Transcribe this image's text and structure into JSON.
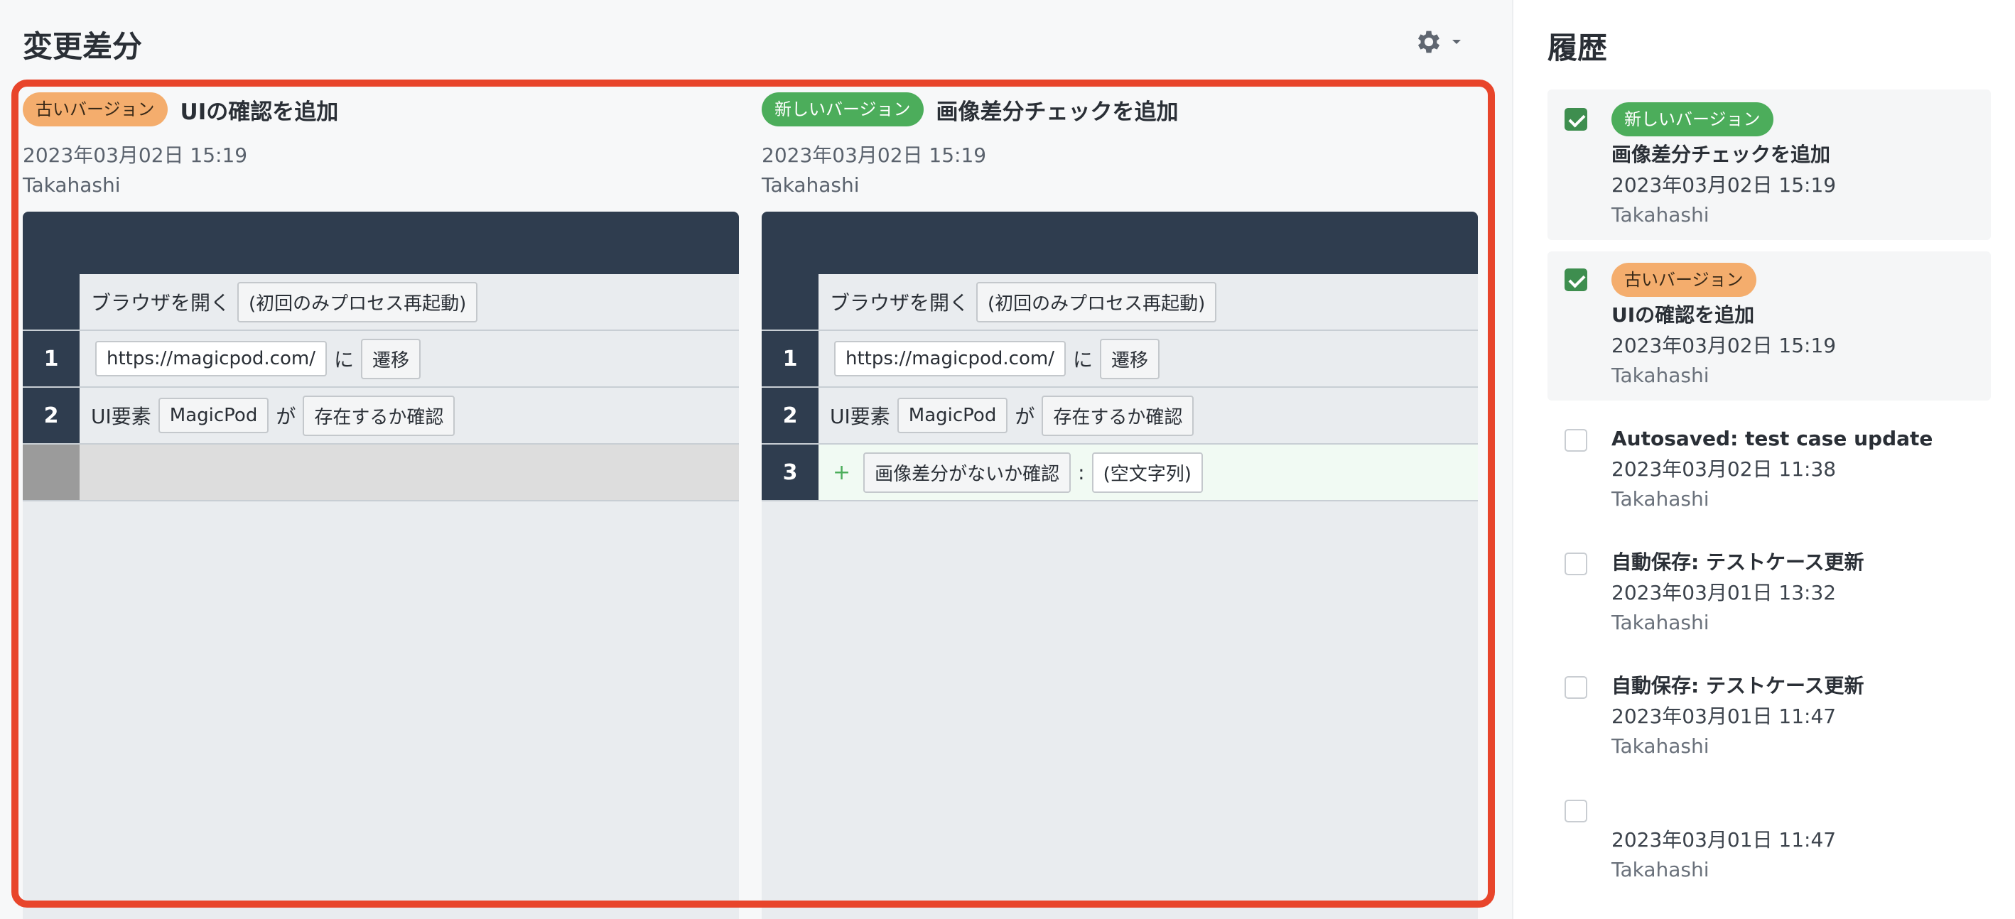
{
  "main": {
    "title": "変更差分",
    "settings_icon": "gear-icon"
  },
  "old_panel": {
    "badge": "古いバージョン",
    "title": "UIの確認を追加",
    "date": "2023年03月02日 15:19",
    "author": "Takahashi",
    "steps": [
      {
        "num": "",
        "parts": [
          "ブラウザを開く",
          "(初回のみプロセス再起動)"
        ]
      },
      {
        "num": "1",
        "parts": [
          "https://magicpod.com/",
          "に",
          "遷移"
        ]
      },
      {
        "num": "2",
        "parts": [
          "UI要素",
          "MagicPod",
          "が",
          "存在するか確認"
        ]
      }
    ]
  },
  "new_panel": {
    "badge": "新しいバージョン",
    "title": "画像差分チェックを追加",
    "date": "2023年03月02日 15:19",
    "author": "Takahashi",
    "steps": [
      {
        "num": "",
        "parts": [
          "ブラウザを開く",
          "(初回のみプロセス再起動)"
        ]
      },
      {
        "num": "1",
        "parts": [
          "https://magicpod.com/",
          "に",
          "遷移"
        ]
      },
      {
        "num": "2",
        "parts": [
          "UI要素",
          "MagicPod",
          "が",
          "存在するか確認"
        ]
      },
      {
        "num": "3",
        "plus": "+",
        "parts": [
          "画像差分がないか確認",
          ":",
          "(空文字列)"
        ]
      }
    ]
  },
  "history": {
    "title": "履歴",
    "items": [
      {
        "checked": true,
        "badge": "新しいバージョン",
        "badge_color": "#4cad5b",
        "title": "画像差分チェックを追加",
        "date": "2023年03月02日 15:19",
        "author": "Takahashi"
      },
      {
        "checked": true,
        "badge": "古いバージョン",
        "badge_color": "#f4ad6d",
        "title": "UIの確認を追加",
        "date": "2023年03月02日 15:19",
        "author": "Takahashi"
      },
      {
        "checked": false,
        "title": "Autosaved: test case update",
        "date": "2023年03月02日 11:38",
        "author": "Takahashi"
      },
      {
        "checked": false,
        "title": "自動保存: テストケース更新",
        "date": "2023年03月01日 13:32",
        "author": "Takahashi"
      },
      {
        "checked": false,
        "title": "自動保存: テストケース更新",
        "date": "2023年03月01日 11:47",
        "author": "Takahashi"
      },
      {
        "checked": false,
        "title": "",
        "date": "2023年03月01日 11:47",
        "author": "Takahashi"
      }
    ]
  },
  "colors": {
    "highlight_frame": "#e8452b",
    "header_dark": "#2f3d4f",
    "new_badge": "#4cad5b",
    "old_badge": "#f4ad6d",
    "added_row": "#f1faf3"
  }
}
